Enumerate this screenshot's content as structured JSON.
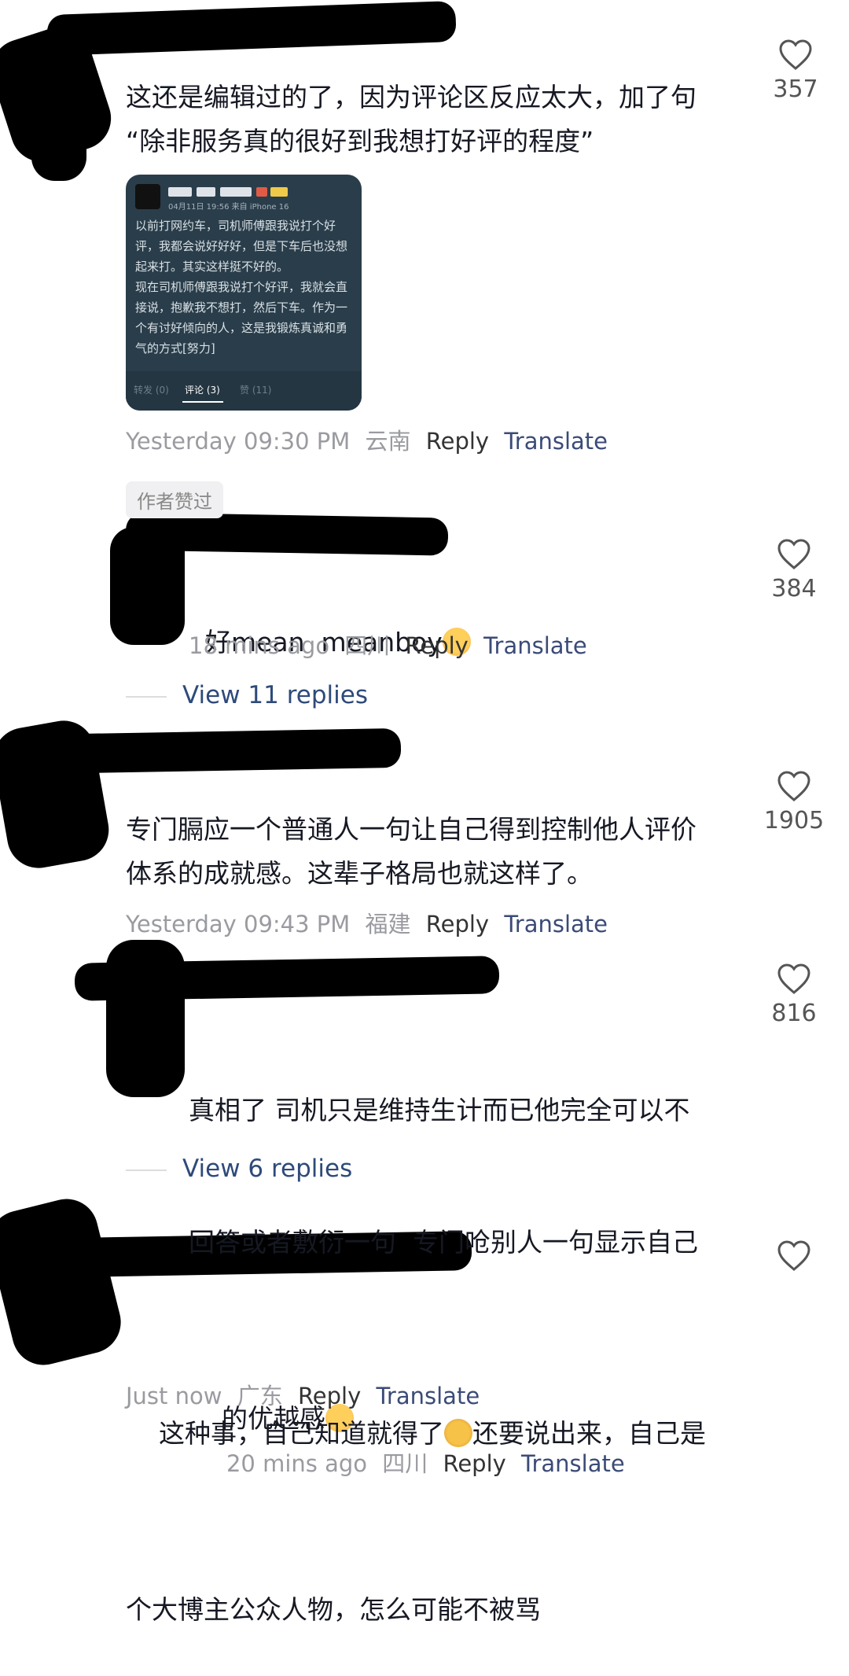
{
  "colors": {
    "text": "#161823",
    "meta": "#9a9ba0",
    "translate": "#3b4b77",
    "view_replies": "#2e4a7a"
  },
  "comments": [
    {
      "text": "这还是编辑过的了，因为评论区反应太大，加了句\n“除非服务真的很好到我想打好评的程度”",
      "likes": "357",
      "time": "Yesterday 09:30 PM",
      "location": "云南",
      "reply": "Reply",
      "translate": "Translate"
    },
    {
      "badge": "作者赞过",
      "text": "好mean  meanboy",
      "likes": "384",
      "time": "18 mins ago",
      "location": "四川",
      "reply": "Reply",
      "translate": "Translate",
      "view_replies": "View 11 replies"
    },
    {
      "text": "专门膈应一个普通人一句让自己得到控制他人评价\n体系的成就感。这辈子格局也就这样了。",
      "likes": "1905",
      "time": "Yesterday 09:43 PM",
      "location": "福建",
      "reply": "Reply",
      "translate": "Translate"
    },
    {
      "text_line1": "真相了 司机只是维持生计而已他完全可以不",
      "text_line2": "回答或者敷衍一句  专门呛别人一句显示自己",
      "text_line3": "的优越感",
      "likes": "816",
      "time": "20 mins ago",
      "location": "四川",
      "reply": "Reply",
      "translate": "Translate",
      "view_replies": "View 6 replies"
    },
    {
      "text_part1": "这种事，自己知道就得了",
      "text_part2": "还要说出来，自己是",
      "text_line2": "个大博主公众人物，怎么可能不被骂",
      "time": "Just now",
      "location": "广东",
      "reply": "Reply",
      "translate": "Translate"
    }
  ],
  "embedded_post": {
    "subtitle": "04月11日 19:56 来自 iPhone 16",
    "body": "以前打网约车，司机师傅跟我说打个好评，我都会说好好好，但是下车后也没想起来打。其实这样挺不好的。\n现在司机师傅跟我说打个好评，我就会直接说，抱歉我不想打，然后下车。作为一个有讨好倾向的人，这是我锻炼真诚和勇气的方式[努力]",
    "tabs": [
      "转发 (0)",
      "评论 (3)",
      "赞 (11)"
    ]
  }
}
